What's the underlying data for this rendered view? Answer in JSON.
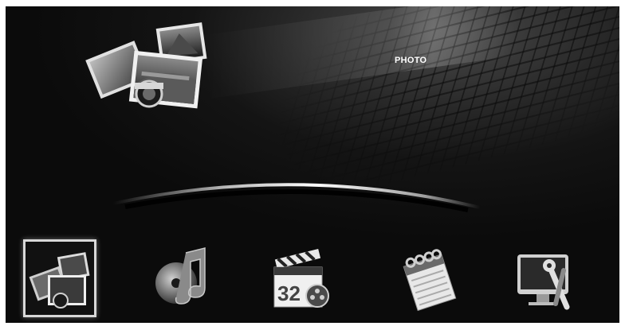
{
  "screen": {
    "title": "PHOTO"
  },
  "hero_icon": {
    "icon": "photo-stack-icon"
  },
  "menu": {
    "items": [
      {
        "id": "photo",
        "icon": "photo-icon",
        "selected": true
      },
      {
        "id": "music",
        "icon": "music-icon",
        "selected": false
      },
      {
        "id": "movie",
        "icon": "movie-icon",
        "selected": false
      },
      {
        "id": "calendar",
        "icon": "calendar-icon",
        "selected": false
      },
      {
        "id": "setup",
        "icon": "settings-icon",
        "selected": false
      }
    ],
    "calendar_day": "32"
  },
  "colors": {
    "background": "#0a0a0a",
    "title": "#ffffff",
    "selection_border": "#d8d8d8"
  }
}
